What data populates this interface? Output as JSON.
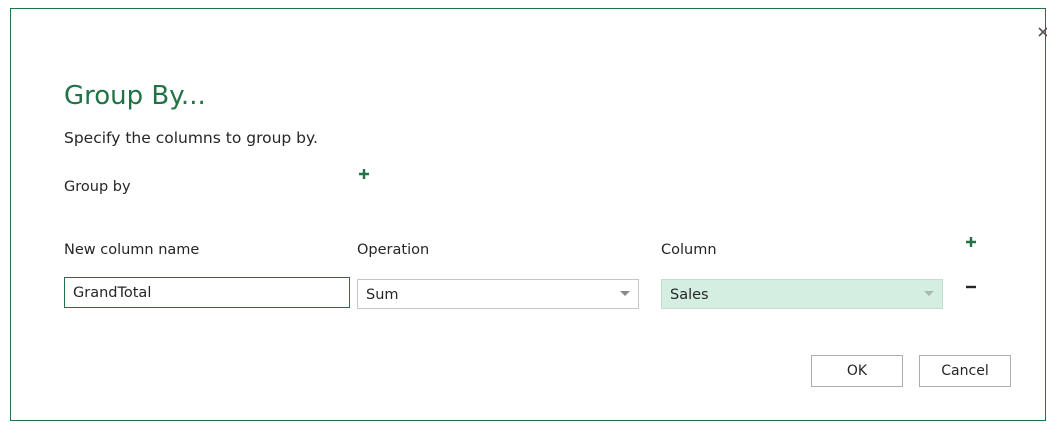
{
  "dialog": {
    "title": "Group By...",
    "subtitle": "Specify the columns to group by.",
    "group_by_label": "Group by",
    "close_icon": "close-icon"
  },
  "aggregation": {
    "headers": {
      "new_column_name": "New column name",
      "operation": "Operation",
      "column": "Column"
    },
    "rows": [
      {
        "new_column_name": "GrandTotal",
        "operation": "Sum",
        "column": "Sales"
      }
    ]
  },
  "buttons": {
    "ok": "OK",
    "cancel": "Cancel"
  },
  "colors": {
    "accent": "#217346",
    "selected_field_bg": "#d4efe2",
    "border": "#c6c6c6"
  }
}
